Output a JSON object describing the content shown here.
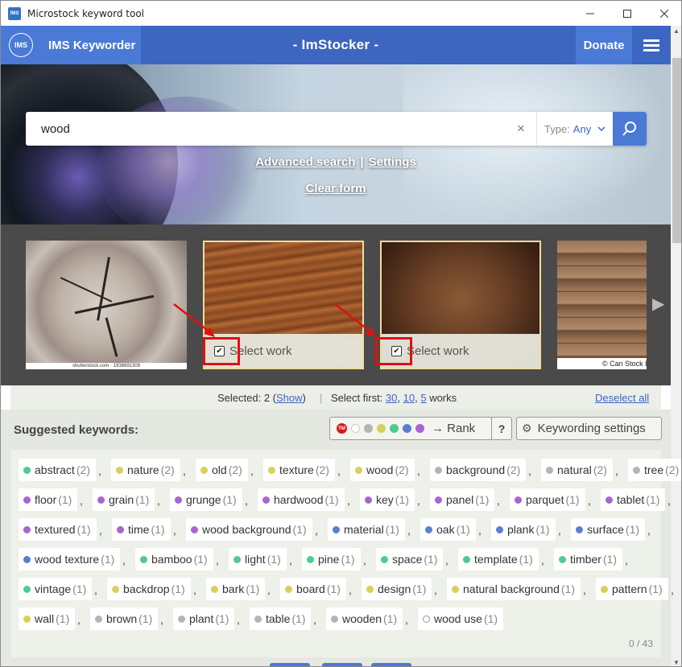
{
  "window": {
    "title": "Microstock keyword tool",
    "app_icon": "IMS"
  },
  "header": {
    "logo": "IMS",
    "brand": "IMS Keyworder",
    "title": "- ImStocker -",
    "donate": "Donate"
  },
  "search": {
    "query": "wood",
    "type_label": "Type:",
    "type_value": "Any",
    "advanced": "Advanced search",
    "settings": "Settings",
    "clear": "Clear form"
  },
  "carousel": {
    "items": [
      {
        "credit": "shutterstock.com · 1938691309",
        "selected": false
      },
      {
        "select_label": "Select work",
        "selected": true
      },
      {
        "select_label": "Select work",
        "selected": true
      },
      {
        "credit": "© Can Stock Photo",
        "selected": false
      }
    ]
  },
  "selection": {
    "selected_prefix": "Selected: 2 (",
    "show": "Show",
    "selected_suffix": ")",
    "select_first": "Select first:",
    "n30": "30",
    "n10": "10",
    "n5": "5",
    "works": "works",
    "deselect": "Deselect all"
  },
  "keywords": {
    "title": "Suggested keywords:",
    "rank": "→ Rank",
    "help": "?",
    "settings": "Keywording settings",
    "tm": "TM",
    "count": "0 / 43",
    "colors": {
      "green": "#4ecb8f",
      "yellow": "#d8d05c",
      "gray": "#b4b4b4",
      "purple": "#a865d0",
      "blue": "#5b7fd0",
      "white": "#ffffff"
    },
    "rows": [
      [
        [
          "abstract",
          "(2)",
          "green"
        ],
        [
          "nature",
          "(2)",
          "yellow"
        ],
        [
          "old",
          "(2)",
          "yellow"
        ],
        [
          "texture",
          "(2)",
          "yellow"
        ],
        [
          "wood",
          "(2)",
          "yellow"
        ],
        [
          "background",
          "(2)",
          "gray"
        ],
        [
          "natural",
          "(2)",
          "gray"
        ],
        [
          "tree",
          "(2)",
          "gray"
        ]
      ],
      [
        [
          "floor",
          "(1)",
          "purple"
        ],
        [
          "grain",
          "(1)",
          "purple"
        ],
        [
          "grunge",
          "(1)",
          "purple"
        ],
        [
          "hardwood",
          "(1)",
          "purple"
        ],
        [
          "key",
          "(1)",
          "purple"
        ],
        [
          "panel",
          "(1)",
          "purple"
        ],
        [
          "parquet",
          "(1)",
          "purple"
        ],
        [
          "tablet",
          "(1)",
          "purple"
        ]
      ],
      [
        [
          "textured",
          "(1)",
          "purple"
        ],
        [
          "time",
          "(1)",
          "purple"
        ],
        [
          "wood background",
          "(1)",
          "purple"
        ],
        [
          "material",
          "(1)",
          "blue"
        ],
        [
          "oak",
          "(1)",
          "blue"
        ],
        [
          "plank",
          "(1)",
          "blue"
        ],
        [
          "surface",
          "(1)",
          "blue"
        ]
      ],
      [
        [
          "wood texture",
          "(1)",
          "blue"
        ],
        [
          "bamboo",
          "(1)",
          "green"
        ],
        [
          "light",
          "(1)",
          "green"
        ],
        [
          "pine",
          "(1)",
          "green"
        ],
        [
          "space",
          "(1)",
          "green"
        ],
        [
          "template",
          "(1)",
          "green"
        ],
        [
          "timber",
          "(1)",
          "green"
        ]
      ],
      [
        [
          "vintage",
          "(1)",
          "green"
        ],
        [
          "backdrop",
          "(1)",
          "yellow"
        ],
        [
          "bark",
          "(1)",
          "yellow"
        ],
        [
          "board",
          "(1)",
          "yellow"
        ],
        [
          "design",
          "(1)",
          "yellow"
        ],
        [
          "natural background",
          "(1)",
          "yellow"
        ],
        [
          "pattern",
          "(1)",
          "yellow"
        ]
      ],
      [
        [
          "wall",
          "(1)",
          "yellow"
        ],
        [
          "brown",
          "(1)",
          "gray"
        ],
        [
          "plant",
          "(1)",
          "gray"
        ],
        [
          "table",
          "(1)",
          "gray"
        ],
        [
          "wooden",
          "(1)",
          "gray"
        ],
        [
          "wood use",
          "(1)",
          "white"
        ]
      ]
    ]
  }
}
